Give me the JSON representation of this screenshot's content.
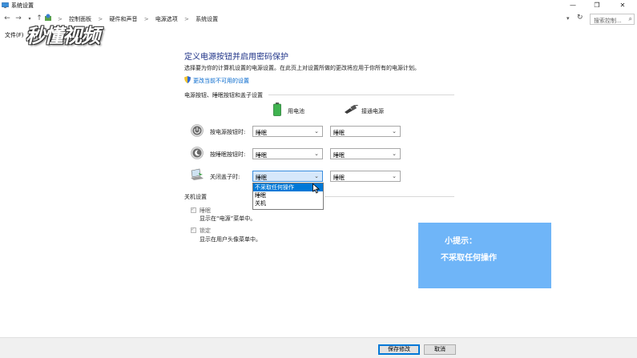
{
  "window": {
    "title": "系统设置",
    "minimize": "—",
    "maximize": "❐",
    "close": "✕"
  },
  "address": {
    "crumbs": [
      "控制面板",
      "硬件和声音",
      "电源选项",
      "系统设置"
    ],
    "separator": ">",
    "search_placeholder": "搜索控制..."
  },
  "menu": {
    "file": "文件(F)"
  },
  "watermark": "秒懂视频",
  "main": {
    "heading": "定义电源按钮并启用密码保护",
    "description": "选择要为你的计算机设置的电源设置。在此页上对设置所做的更改将应用于你所有的电源计划。",
    "change_link": "更改当前不可用的设置"
  },
  "power_section": {
    "title": "电源按钮、睡眠按钮和盖子设置",
    "columns": [
      "用电池",
      "接通电源"
    ],
    "rows": [
      {
        "label": "按电源按钮时:",
        "battery": "睡眠",
        "plugged": "睡眠"
      },
      {
        "label": "按睡眠按钮时:",
        "battery": "睡眠",
        "plugged": "睡眠"
      },
      {
        "label": "关闭盖子时:",
        "battery": "睡眠",
        "plugged": "睡眠"
      }
    ],
    "dropdown_options": [
      "不采取任何操作",
      "睡眠",
      "关机"
    ]
  },
  "shutdown_section": {
    "title": "关机设置",
    "items": [
      {
        "label": "睡眠",
        "desc": "显示在“电源”菜单中。"
      },
      {
        "label": "锁定",
        "desc": "显示在用户头像菜单中。"
      }
    ]
  },
  "tip": {
    "title": "小提示：",
    "body": "不采取任何操作"
  },
  "buttons": {
    "save": "保存修改",
    "cancel": "取消"
  }
}
